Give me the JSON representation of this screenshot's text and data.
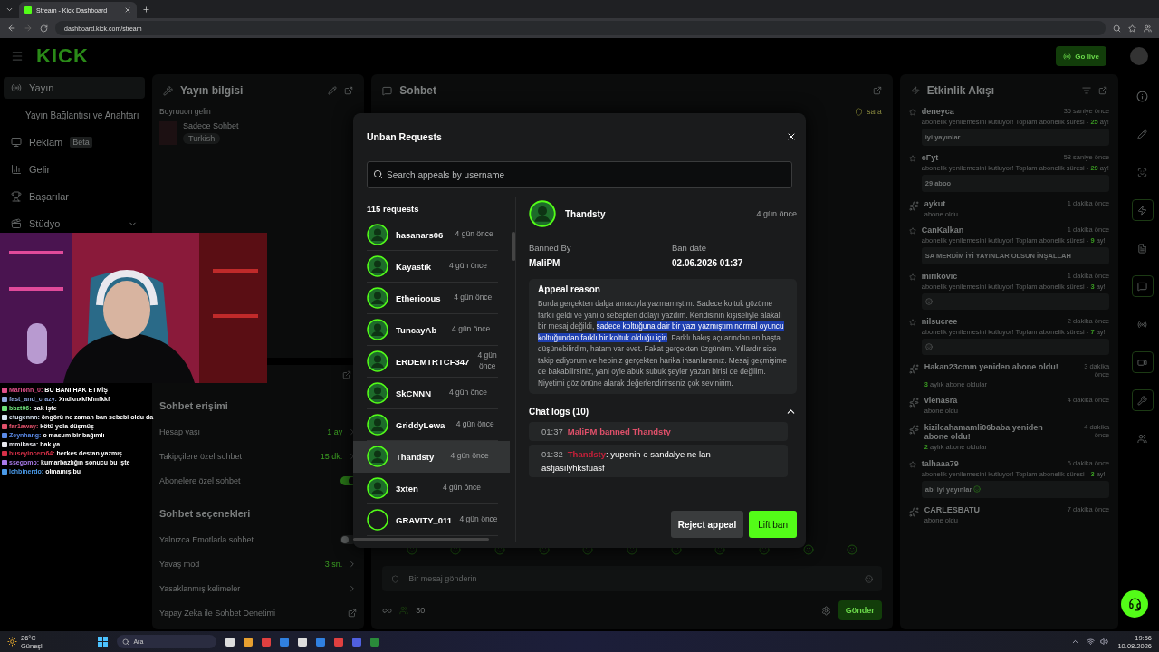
{
  "browser": {
    "tab_title": "Stream - Kick Dashboard",
    "url": "dashboard.kick.com/stream"
  },
  "header": {
    "logo": "KICK",
    "go_live": "Go live"
  },
  "sidebar": {
    "items": [
      {
        "label": "Yayın",
        "selected": true
      },
      {
        "label": "Yayın Bağlantısı ve Anahtarı",
        "selected": false
      },
      {
        "label": "Reklam",
        "badge": "Beta",
        "selected": false
      },
      {
        "label": "Gelir",
        "selected": false
      },
      {
        "label": "Başarılar",
        "selected": false
      },
      {
        "label": "Stüdyo",
        "selected": false,
        "expanded": false
      }
    ]
  },
  "stream_info": {
    "title": "Yayın bilgisi",
    "stream_title": "Buyruuon gelin",
    "category": "Sadece Sohbet",
    "language": "Turkish"
  },
  "chat_settings": {
    "sections": [
      {
        "title": "Sohbet erişimi",
        "rows": [
          {
            "kind": "value",
            "label": "Hesap yaşı",
            "value": "1 ay"
          },
          {
            "kind": "value",
            "label": "Takipçilere özel sohbet",
            "value": "15 dk."
          },
          {
            "kind": "toggle",
            "label": "Abonelere özel sohbet",
            "on": true
          }
        ]
      },
      {
        "title": "Sohbet seçenekleri",
        "rows": [
          {
            "kind": "toggle",
            "label": "Yalnızca Emotlarla sohbet",
            "on": false
          },
          {
            "kind": "value",
            "label": "Yavaş mod",
            "value": "3 sn."
          },
          {
            "kind": "link",
            "label": "Yasaklanmış kelimeler"
          },
          {
            "kind": "external",
            "label": "Yapay Zeka ile Sohbet Denetimi"
          }
        ]
      }
    ]
  },
  "overlay_chat": [
    {
      "user": "Marionn_0:",
      "color": "#e0508a",
      "text": "BU BANI HAK ETMİŞ"
    },
    {
      "user": "fast_and_crazy:",
      "color": "#8fa8e0",
      "text": "Xndknxkfkfmfkkf"
    },
    {
      "user": "bbzt06:",
      "color": "#6ee07a",
      "text": "bak işte"
    },
    {
      "user": "etugennn:",
      "color": "#d8e4f0",
      "text": "öngörü ne zaman ban sebebi oldu da"
    },
    {
      "user": "far1away:",
      "color": "#e0506a",
      "text": "kötü yola düşmüş"
    },
    {
      "user": "Zeynhang:",
      "color": "#5a8ae8",
      "text": "o masum bir bağımlı"
    },
    {
      "user": "mmikasa:",
      "color": "#e8e8ee",
      "text": "bak ya"
    },
    {
      "user": "huseyincem64:",
      "color": "#d83048",
      "text": "herkes destan yazmış"
    },
    {
      "user": "ssegomo:",
      "color": "#a87ae8",
      "text": "kumarbazlığın sonucu bu işte"
    },
    {
      "user": "lchbinerdo:",
      "color": "#4a9ae8",
      "text": "olmamış bu"
    }
  ],
  "chat": {
    "title": "Sohbet",
    "pinned_user": "sara",
    "placeholder": "Bir mesaj gönderin",
    "viewer_count": "30",
    "send": "Gönder"
  },
  "activity": {
    "title": "Etkinlik Akışı",
    "items": [
      {
        "kind": "renewal",
        "user": "deneyca",
        "time": "35 saniye önce",
        "detail": "abonelik yenilemesini kutluyor! Toplam abonelik süresi - **25** ay!",
        "message": "iyi yayınlar"
      },
      {
        "kind": "renewal",
        "user": "cFyt",
        "time": "58 saniye önce",
        "detail": "abonelik yenilemesini kutluyor! Toplam abonelik süresi - **29** ay!",
        "message": "29 aboo"
      },
      {
        "kind": "sub",
        "user": "aykut",
        "time": "1 dakika önce",
        "detail": "abone oldu"
      },
      {
        "kind": "renewal",
        "user": "CanKalkan",
        "time": "1 dakika önce",
        "detail": "abonelik yenilemesini kutluyor! Toplam abonelik süresi - **9** ay!",
        "message": "SA MERDİM İYİ YAYINLAR OLSUN İNŞALLAH"
      },
      {
        "kind": "renewal",
        "user": "mirikovic",
        "time": "1 dakika önce",
        "detail": "abonelik yenilemesini kutluyor! Toplam abonelik süresi - **3** ay!",
        "emote": true
      },
      {
        "kind": "renewal",
        "user": "nilsucree",
        "time": "2 dakika önce",
        "detail": "abonelik yenilemesini kutluyor! Toplam abonelik süresi - **7** ay!",
        "emote": true
      },
      {
        "kind": "resub",
        "user": "Hakan23cmm yeniden abone oldu!",
        "time": "3 dakika önce",
        "detail": "**3** aylık abone oldular"
      },
      {
        "kind": "sub",
        "user": "vienasra",
        "time": "4 dakika önce",
        "detail": "abone oldu"
      },
      {
        "kind": "resub",
        "user": "kizilcahamamli06baba yeniden abone oldu!",
        "time": "4 dakika önce",
        "detail": "**2** aylık abone oldular"
      },
      {
        "kind": "renewal",
        "user": "talhaaa79",
        "time": "6 dakika önce",
        "detail": "abonelik yenilemesini kutluyor! Toplam abonelik süresi - **3** ay!",
        "message": "abi iyi yayınlar",
        "emote": true
      },
      {
        "kind": "sub",
        "user": "CARLESBATU",
        "time": "7 dakika önce",
        "detail": "abone oldu"
      }
    ]
  },
  "modal": {
    "title": "Unban Requests",
    "search_placeholder": "Search appeals by username",
    "count": "115 requests",
    "requests": [
      {
        "user": "hasanars06",
        "time": "4 gün önce",
        "selected": false
      },
      {
        "user": "Kayastik",
        "time": "4 gün önce",
        "selected": false
      },
      {
        "user": "Etherioous",
        "time": "4 gün önce",
        "selected": false
      },
      {
        "user": "TuncayAb",
        "time": "4 gün önce",
        "selected": false
      },
      {
        "user": "ERDEMTRTCF347",
        "time": "4 gün önce",
        "selected": false
      },
      {
        "user": "SkCNNN",
        "time": "4 gün önce",
        "selected": false
      },
      {
        "user": "GriddyLewa",
        "time": "4 gün önce",
        "selected": false
      },
      {
        "user": "Thandsty",
        "time": "4 gün önce",
        "selected": true
      },
      {
        "user": "3xten",
        "time": "4 gün önce",
        "selected": false
      },
      {
        "user": "GRAVITY_011",
        "time": "4 gün önce",
        "selected": false
      }
    ],
    "detail": {
      "user": "Thandsty",
      "time": "4 gün önce",
      "banned_by_label": "Banned By",
      "banned_by": "MaliPM",
      "ban_date_label": "Ban date",
      "ban_date": "02.06.2026 01:37",
      "reason_title": "Appeal reason",
      "reason": [
        {
          "text": "Burda gerçekten dalga amacıyla yazmamıştım. Sadece koltuk gözüme farklı geldi ve yani o sebepten dolayı yazdım. Kendisinin kişiseliyle alakalı bir mesaj değildi, ",
          "highlighted": false
        },
        {
          "text": "sadece koltuğuna dair bir yazı yazmıştım normal oyuncu koltuğundan farklı bir koltuk olduğu için",
          "highlighted": true
        },
        {
          "text": ". Farklı bakış açılarından en başta düşünebilirdim, hatam var evet. Fakat gerçekten üzgünüm. Yıllardır size takip ediyorum ve hepiniz gerçekten harika insanlarsınız. Mesaj geçmişime de bakabilirsiniz, yani öyle abuk subuk şeyler yazan birisi de değilim. Niyetimi göz önüne alarak değerlendirirseniz çok sevinirim.",
          "highlighted": false
        }
      ],
      "logs_title": "Chat logs (10)",
      "logs_expanded": true,
      "logs": [
        {
          "kind": "ban",
          "time": "01:37",
          "text": "MaliPM banned Thandsty"
        },
        {
          "kind": "message",
          "time": "01:32",
          "user": "Thandsty",
          "text": ": yupenin o sandalye ne lan asfjasılyhksfuasf"
        }
      ],
      "reject": "Reject appeal",
      "lift": "Lift ban"
    }
  },
  "taskbar": {
    "temperature": "26°C",
    "weather": "Güneşli",
    "search": "Ara",
    "time": "19:56",
    "date": "10.08.2026"
  }
}
